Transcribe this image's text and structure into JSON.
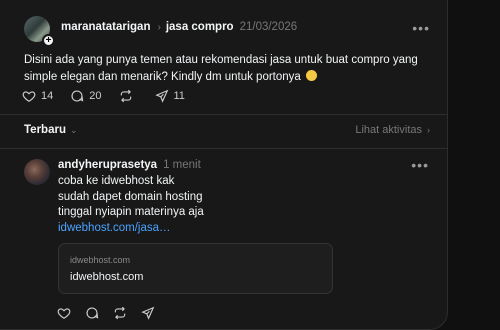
{
  "post": {
    "username": "maranatatarigan",
    "topic": "jasa compro",
    "date": "21/03/2026",
    "text": "Disini ada yang punya temen atau rekomendasi jasa untuk buat compro yang simple elegan dan menarik? Kindly dm untuk portonya",
    "emoji": "grimacing-face",
    "stats": {
      "likes": "14",
      "replies": "20",
      "reposts": "",
      "shares": "11"
    }
  },
  "sort": {
    "label": "Terbaru",
    "activity_label": "Lihat aktivitas"
  },
  "reply": {
    "username": "andyheruprasetya",
    "time": "1 menit",
    "lines": [
      "coba ke idwebhost kak",
      "sudah dapet domain hosting",
      "tinggal nyiapin materinya aja"
    ],
    "link_text": "idwebhost.com/jasa…",
    "card": {
      "domain": "idwebhost.com",
      "title": "idwebhost.com"
    }
  },
  "icons": [
    "heart-icon",
    "comment-icon",
    "repost-icon",
    "share-icon",
    "more-icon",
    "chevron-right-icon",
    "chevron-down-icon",
    "plus-icon"
  ],
  "colors": {
    "background": "#181818",
    "link": "#4aa3ff",
    "muted": "#777777",
    "text": "#f3f5f7"
  }
}
